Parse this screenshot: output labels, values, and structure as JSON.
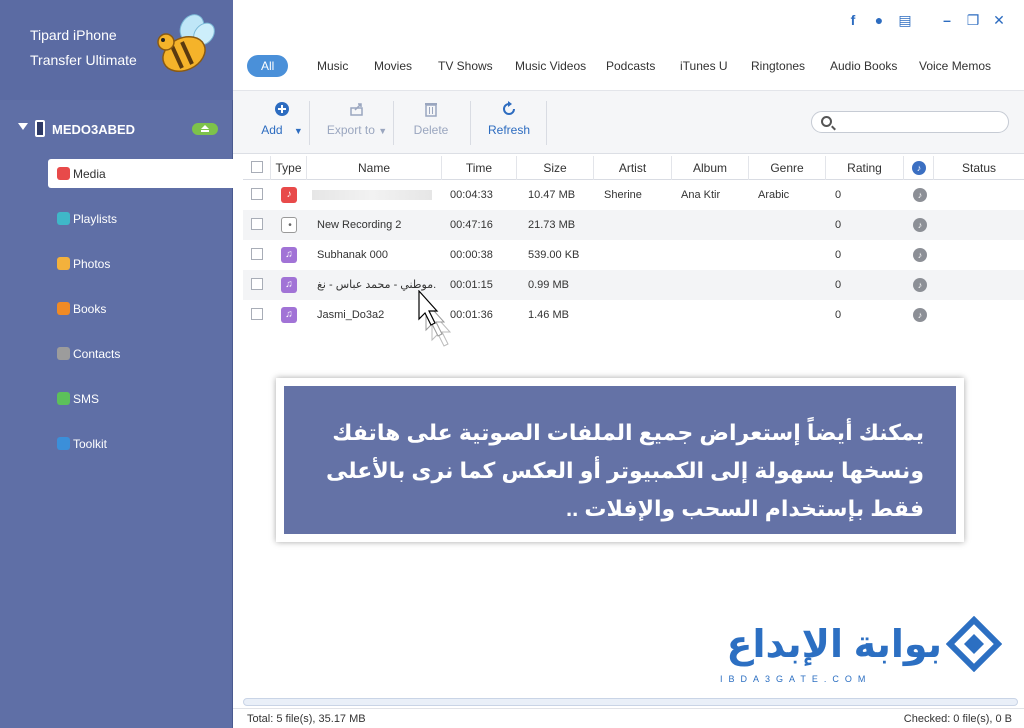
{
  "app": {
    "title_line1": "Tipard iPhone",
    "title_line2": "Transfer Ultimate"
  },
  "device": {
    "name": "MEDO3ABED"
  },
  "sidebar": {
    "items": [
      {
        "label": "Media",
        "icon": "music-icon",
        "color": "#e84a4a"
      },
      {
        "label": "Playlists",
        "icon": "playlist-icon",
        "color": "#3fb7c8"
      },
      {
        "label": "Photos",
        "icon": "photos-icon",
        "color": "#f3b13c"
      },
      {
        "label": "Books",
        "icon": "book-icon",
        "color": "#f08a24"
      },
      {
        "label": "Contacts",
        "icon": "contacts-icon",
        "color": "#9c9c9c"
      },
      {
        "label": "SMS",
        "icon": "message-icon",
        "color": "#5cc05a"
      },
      {
        "label": "Toolkit",
        "icon": "toolkit-icon",
        "color": "#3b8fd9"
      }
    ]
  },
  "tabs": [
    "All",
    "Music",
    "Movies",
    "TV Shows",
    "Music Videos",
    "Podcasts",
    "iTunes U",
    "Ringtones",
    "Audio Books",
    "Voice Memos"
  ],
  "toolbar": {
    "add": "Add",
    "export": "Export to",
    "delete": "Delete",
    "refresh": "Refresh",
    "search_value": ""
  },
  "table": {
    "columns": [
      "Type",
      "Name",
      "Time",
      "Size",
      "Artist",
      "Album",
      "Genre",
      "Rating",
      "Status"
    ],
    "rows": [
      {
        "type": "music",
        "name": "",
        "time": "00:04:33",
        "size": "10.47 MB",
        "artist": "Sherine",
        "album": "Ana Ktir",
        "genre": "Arabic",
        "rating": "0"
      },
      {
        "type": "voice",
        "name": "New Recording 2",
        "time": "00:47:16",
        "size": "21.73 MB",
        "artist": "",
        "album": "",
        "genre": "",
        "rating": "0"
      },
      {
        "type": "ring",
        "name": "Subhanak 000",
        "time": "00:00:38",
        "size": "539.00 KB",
        "artist": "",
        "album": "",
        "genre": "",
        "rating": "0"
      },
      {
        "type": "ring",
        "name": "موطني - محمد عباس - نغ...",
        "time": "00:01:15",
        "size": "0.99 MB",
        "artist": "",
        "album": "",
        "genre": "",
        "rating": "0"
      },
      {
        "type": "ring",
        "name": "Jasmi_Do3a2",
        "time": "00:01:36",
        "size": "1.46 MB",
        "artist": "",
        "album": "",
        "genre": "",
        "rating": "0"
      }
    ]
  },
  "overlay": {
    "text": "يمكنك أيضاً إستعراض جميع الملفات الصوتية على هاتفك ونسخها بسهولة إلى الكمبيوتر أو العكس كما نرى بالأعلى فقط بإستخدام السحب والإفلات .."
  },
  "watermark": {
    "arabic": "بوابة الإبداع",
    "latin": "IBDA3GATE.COM"
  },
  "status": {
    "total": "Total: 5 file(s), 35.17 MB",
    "checked": "Checked: 0 file(s), 0 B"
  },
  "colors": {
    "sidebar": "#5f6fa6",
    "accent": "#4a90d9",
    "overlay": "#6472a6",
    "link": "#2d6cc0"
  }
}
